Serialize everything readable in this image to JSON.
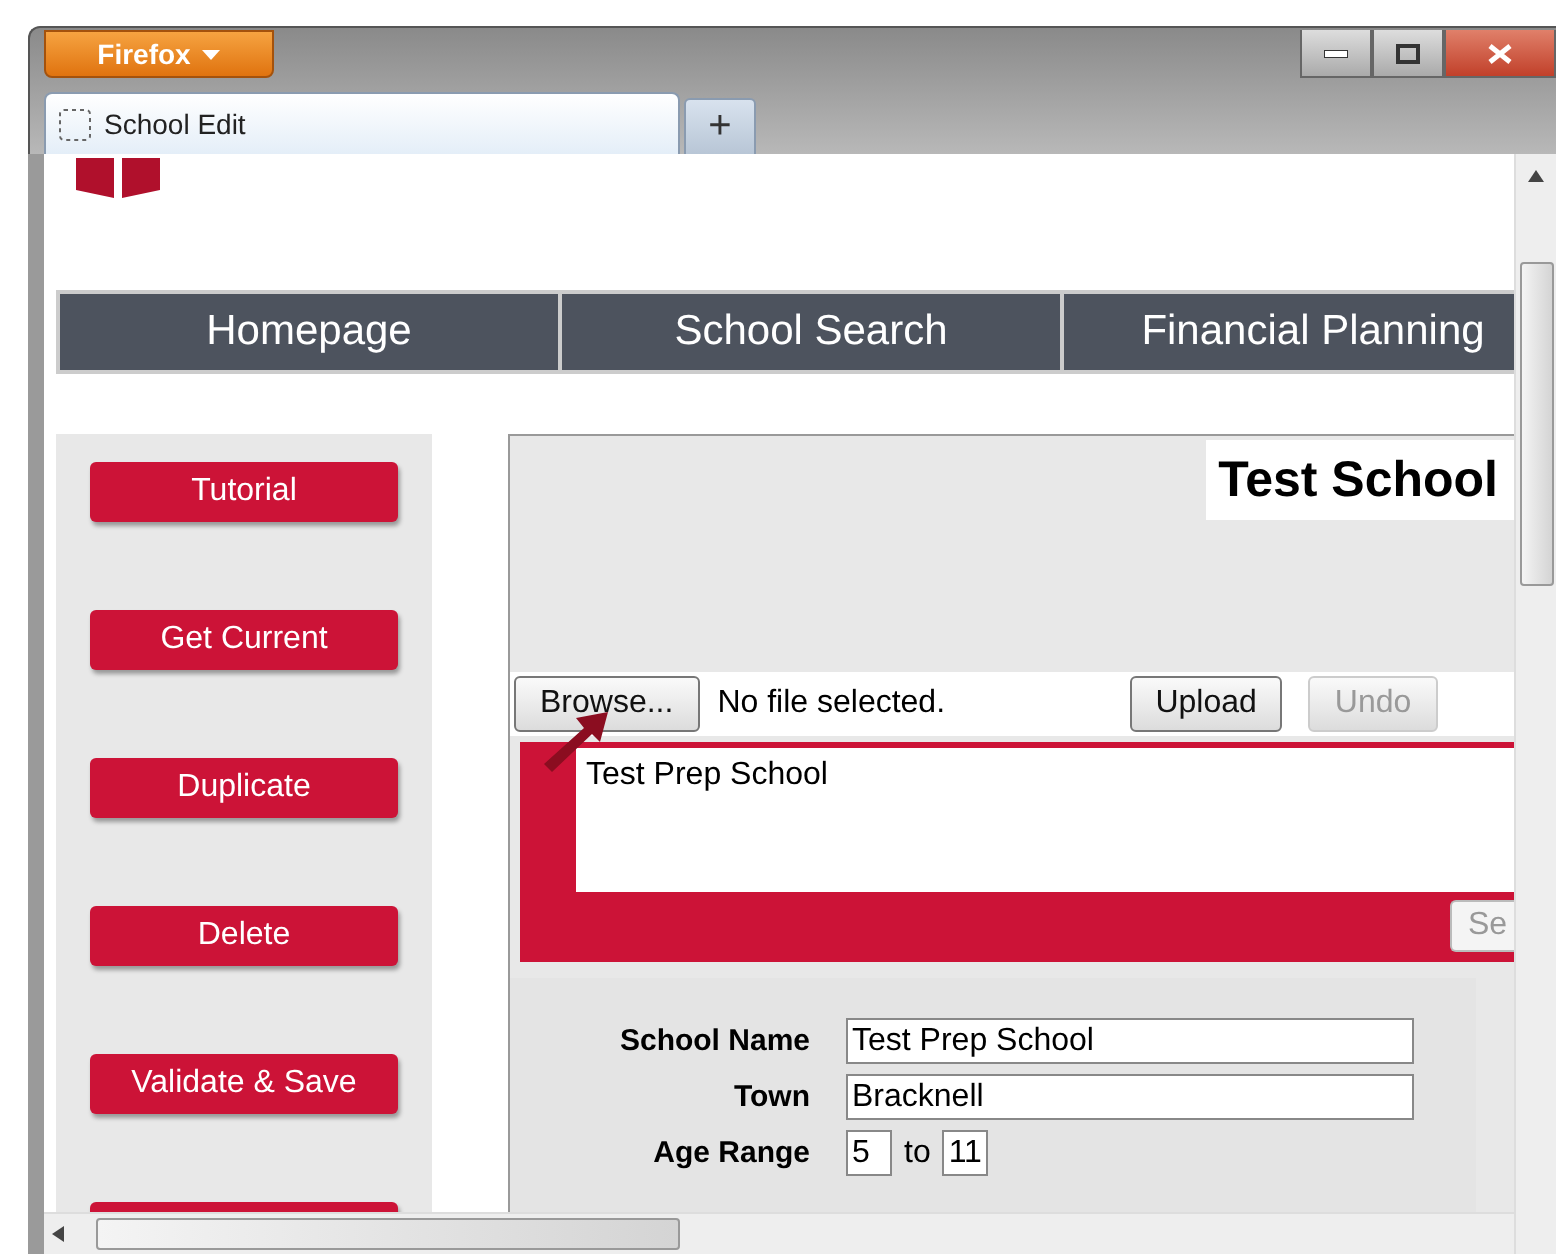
{
  "browser": {
    "menu_button": "Firefox",
    "tabs": [
      {
        "title": "School Edit",
        "selected": true
      }
    ],
    "new_tab": "+"
  },
  "nav": [
    "Homepage",
    "School Search",
    "Financial Planning"
  ],
  "sidebar_buttons": [
    "Tutorial",
    "Get Current",
    "Duplicate",
    "Delete",
    "Validate & Save"
  ],
  "title": "Test School",
  "upload": {
    "browse": "Browse...",
    "file_status": "No file selected.",
    "upload": "Upload",
    "undo": {
      "label": "Undo",
      "disabled": true
    }
  },
  "description": {
    "value": "Test Prep School",
    "button": "Se"
  },
  "form": {
    "school_name": {
      "label": "School Name",
      "value": "Test Prep School"
    },
    "town": {
      "label": "Town",
      "value": "Bracknell"
    },
    "age_range": {
      "label": "Age Range",
      "from": "5",
      "to_label": "to",
      "to": "11"
    }
  }
}
